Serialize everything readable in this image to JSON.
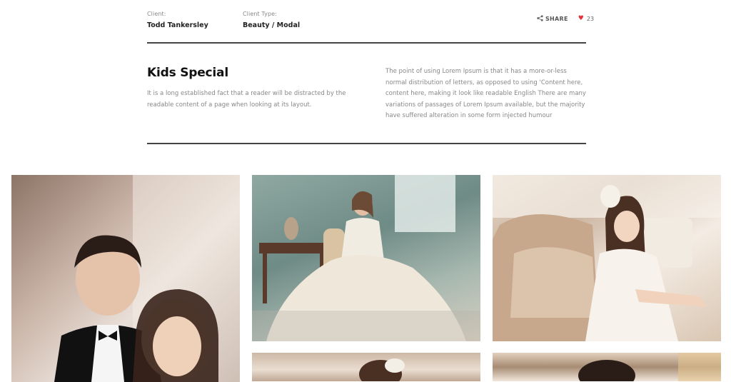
{
  "meta": {
    "client_label": "Client:",
    "client_value": "Todd Tankersley",
    "type_label": "Client Type:",
    "type_value": "Beauty / Modal"
  },
  "actions": {
    "share_icon": "share-icon",
    "share_label": "SHARE",
    "like_icon": "heart-icon",
    "likes_count": "23",
    "heart_color": "#e2333a"
  },
  "project": {
    "title": "Kids Special",
    "lead": "It is a long established fact that a reader will be distracted by the readable content of a page when looking at its layout.",
    "description": "The point of using Lorem Ipsum is that it has a more-or-less normal distribution of letters, as opposed to using 'Content here, content here, making it look like readable English There are many variations of passages of Lorem Ipsum available, but the majority have suffered alteration in some form injected humour"
  },
  "gallery": {
    "images": [
      {
        "name": "couple-portrait-photo"
      },
      {
        "name": "bride-seated-by-window-photo"
      },
      {
        "name": "bride-on-sofa-photo"
      },
      {
        "name": "bride-photo-4"
      },
      {
        "name": "couple-photo-5"
      }
    ]
  }
}
